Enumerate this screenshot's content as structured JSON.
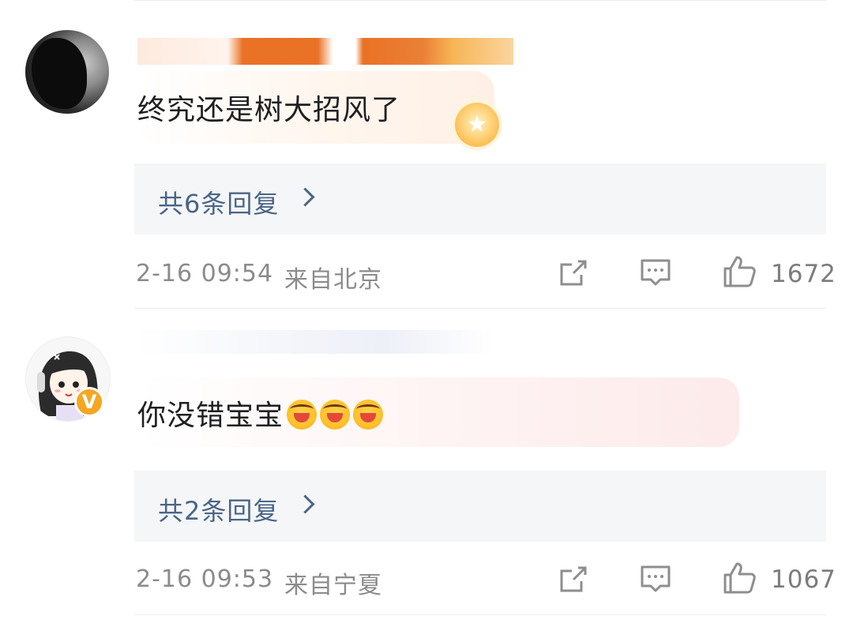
{
  "comments": [
    {
      "text": "终究还是树大招风了",
      "replies_label": "共6条回复",
      "time": "2-16 09:54",
      "location": "来自北京",
      "likes": "1672"
    },
    {
      "text": "你没错宝宝",
      "replies_label": "共2条回复",
      "time": "2-16 09:53",
      "location": "来自宁夏",
      "likes": "1067"
    }
  ],
  "colors": {
    "reply_link": "#4a6587",
    "meta_gray": "#8b8b8b",
    "reply_bg": "#f5f6f8",
    "vip_badge": "#f5a623"
  },
  "icons": [
    "share-icon",
    "comment-icon",
    "like-icon",
    "verified-badge-icon",
    "star-badge-icon",
    "hug-emoji-icon"
  ]
}
